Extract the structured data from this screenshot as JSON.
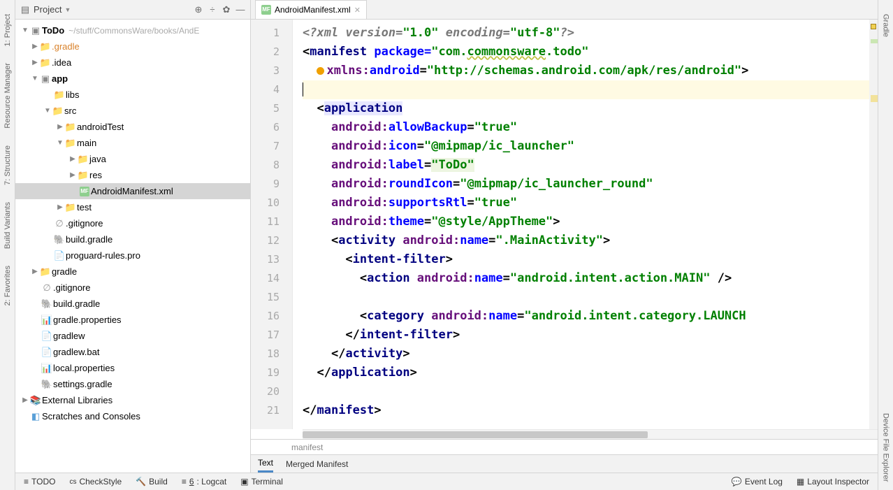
{
  "left_tabs": [
    "1: Project",
    "Resource Manager",
    "7: Structure",
    "Build Variants",
    "2: Favorites"
  ],
  "right_tabs": [
    "Gradle",
    "Device File Explorer"
  ],
  "panel": {
    "title": "Project"
  },
  "tree": {
    "root": "ToDo",
    "root_path": "~/stuff/CommonsWare/books/AndE",
    "gradle_dir": ".gradle",
    "idea_dir": ".idea",
    "app": "app",
    "libs": "libs",
    "src": "src",
    "androidTest": "androidTest",
    "main": "main",
    "java": "java",
    "res": "res",
    "manifest": "AndroidManifest.xml",
    "test": "test",
    "gitignore1": ".gitignore",
    "build_gradle1": "build.gradle",
    "proguard": "proguard-rules.pro",
    "gradle_dir2": "gradle",
    "gitignore2": ".gitignore",
    "build_gradle2": "build.gradle",
    "gradle_props": "gradle.properties",
    "gradlew": "gradlew",
    "gradlew_bat": "gradlew.bat",
    "local_props": "local.properties",
    "settings_gradle": "settings.gradle",
    "ext_libs": "External Libraries",
    "scratches": "Scratches and Consoles"
  },
  "tab": {
    "title": "AndroidManifest.xml"
  },
  "lines": [
    "1",
    "2",
    "3",
    "4",
    "5",
    "6",
    "7",
    "8",
    "9",
    "10",
    "11",
    "12",
    "13",
    "14",
    "15",
    "16",
    "17",
    "18",
    "19",
    "20",
    "21"
  ],
  "code": {
    "l1a": "<?",
    "l1b": "xml version=",
    "l1c": "\"1.0\"",
    "l1d": " encoding=",
    "l1e": "\"utf-8\"",
    "l1f": "?>",
    "l2a": "<",
    "l2b": "manifest ",
    "l2c": "package=",
    "l2d": "\"com.",
    "l2d2": "commonsware",
    "l2d3": ".todo\"",
    "l3a": "xmlns:",
    "l3b": "android",
    "l3c": "=",
    "l3d": "\"http://schemas.android.com/apk/res/android\"",
    "l3e": ">",
    "l5a": "<",
    "l5b": "application",
    "l6a": "android:",
    "l6b": "allowBackup",
    "l6c": "=",
    "l6d": "\"true\"",
    "l7a": "android:",
    "l7b": "icon",
    "l7c": "=",
    "l7d": "\"@mipmap/ic_launcher\"",
    "l8a": "android:",
    "l8b": "label",
    "l8c": "=",
    "l8d": "\"ToDo\"",
    "l9a": "android:",
    "l9b": "roundIcon",
    "l9c": "=",
    "l9d": "\"@mipmap/ic_launcher_round\"",
    "l10a": "android:",
    "l10b": "supportsRtl",
    "l10c": "=",
    "l10d": "\"true\"",
    "l11a": "android:",
    "l11b": "theme",
    "l11c": "=",
    "l11d": "\"@style/AppTheme\"",
    "l11e": ">",
    "l12a": "<",
    "l12b": "activity ",
    "l12c": "android:",
    "l12d": "name",
    "l12e": "=",
    "l12f": "\".MainActivity\"",
    "l12g": ">",
    "l13a": "<",
    "l13b": "intent-filter",
    "l13c": ">",
    "l14a": "<",
    "l14b": "action ",
    "l14c": "android:",
    "l14d": "name",
    "l14e": "=",
    "l14f": "\"android.intent.action.MAIN\"",
    "l14g": " />",
    "l16a": "<",
    "l16b": "category ",
    "l16c": "android:",
    "l16d": "name",
    "l16e": "=",
    "l16f": "\"android.intent.category.LAUNCH",
    "l17a": "</",
    "l17b": "intent-filter",
    "l17c": ">",
    "l18a": "</",
    "l18b": "activity",
    "l18c": ">",
    "l19a": "</",
    "l19b": "application",
    "l19c": ">",
    "l21a": "</",
    "l21b": "manifest",
    "l21c": ">"
  },
  "breadcrumb": "manifest",
  "editor_tabs": {
    "text": "Text",
    "merged": "Merged Manifest"
  },
  "bottom": {
    "todo": "TODO",
    "checkstyle": "CheckStyle",
    "build": "Build",
    "logcat_pre": "6",
    "logcat_post": ": Logcat",
    "terminal": "Terminal",
    "eventlog": "Event Log",
    "layout": "Layout Inspector"
  }
}
